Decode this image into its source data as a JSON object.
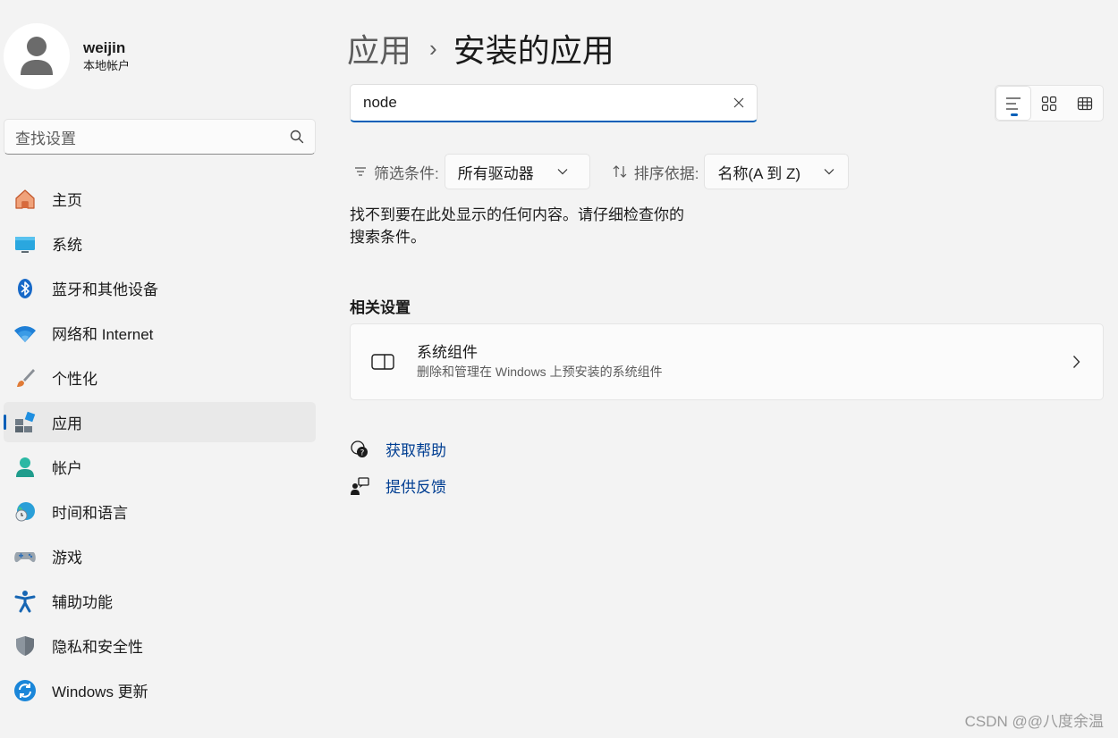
{
  "user": {
    "name": "weijin",
    "account_type": "本地帐户"
  },
  "sidebar": {
    "search_placeholder": "查找设置",
    "items": [
      {
        "label": "主页",
        "icon": "home-icon"
      },
      {
        "label": "系统",
        "icon": "system-icon"
      },
      {
        "label": "蓝牙和其他设备",
        "icon": "bluetooth-icon"
      },
      {
        "label": "网络和 Internet",
        "icon": "wifi-icon"
      },
      {
        "label": "个性化",
        "icon": "brush-icon"
      },
      {
        "label": "应用",
        "icon": "apps-icon",
        "active": true
      },
      {
        "label": "帐户",
        "icon": "account-icon"
      },
      {
        "label": "时间和语言",
        "icon": "globe-clock-icon"
      },
      {
        "label": "游戏",
        "icon": "gamepad-icon"
      },
      {
        "label": "辅助功能",
        "icon": "accessibility-icon"
      },
      {
        "label": "隐私和安全性",
        "icon": "shield-icon"
      },
      {
        "label": "Windows 更新",
        "icon": "update-icon"
      }
    ]
  },
  "breadcrumb": {
    "parent": "应用",
    "separator": "›",
    "current": "安装的应用"
  },
  "app_search": {
    "value": "node"
  },
  "filter": {
    "label": "筛选条件:",
    "value": "所有驱动器"
  },
  "sort": {
    "label": "排序依据:",
    "value": "名称(A 到 Z)"
  },
  "empty_message": "找不到要在此处显示的任何内容。请仔细检查你的搜索条件。",
  "related": {
    "title": "相关设置",
    "card_title": "系统组件",
    "card_subtitle": "删除和管理在 Windows 上预安装的系统组件"
  },
  "links": {
    "help": "获取帮助",
    "feedback": "提供反馈"
  },
  "watermark": "CSDN @@八度余温",
  "colors": {
    "accent": "#005fb8",
    "link": "#003e92",
    "background": "#f3f3f3"
  }
}
